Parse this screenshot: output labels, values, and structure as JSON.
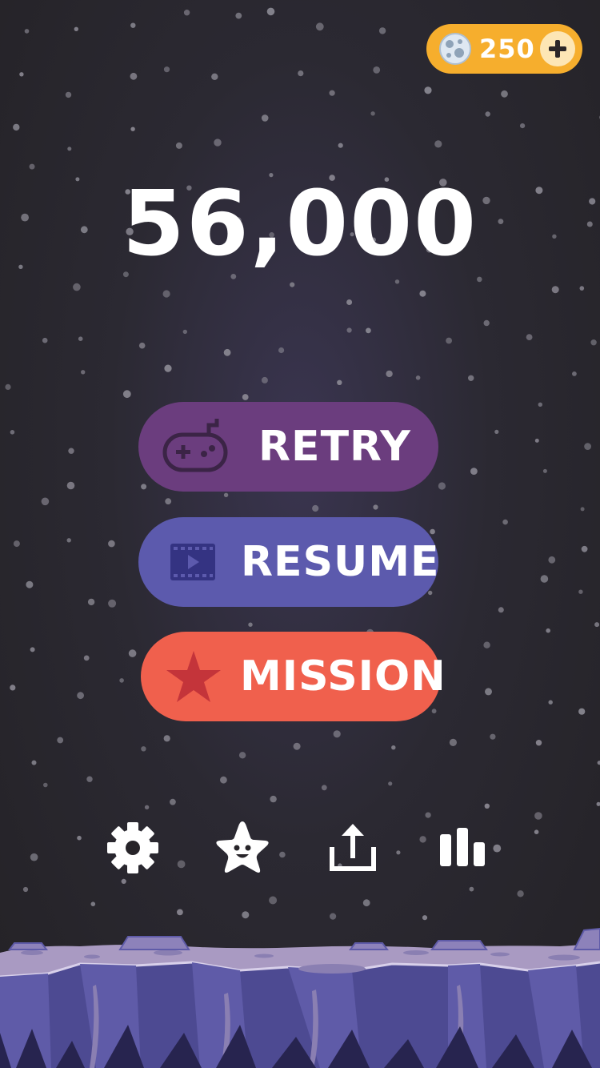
{
  "hud": {
    "coins": "250",
    "coin_icon": "moon-rock-icon",
    "add_icon": "plus-icon"
  },
  "score": "56,000",
  "menu": {
    "retry": {
      "label": "RETRY",
      "icon": "gamepad-icon",
      "color": "#6b3d7e"
    },
    "resume": {
      "label": "RESUME",
      "icon": "video-icon",
      "color": "#5c5aad"
    },
    "mission": {
      "label": "MISSION",
      "icon": "star-icon",
      "color": "#f0604d"
    }
  },
  "toolbar": [
    "gear-icon",
    "star-face-icon",
    "share-icon",
    "leaderboard-icon"
  ],
  "colors": {
    "background": "#2b2932",
    "coin_pill": "#f6ae2d",
    "ground_top": "#a99ac2",
    "cliff": "#4d4a92"
  }
}
